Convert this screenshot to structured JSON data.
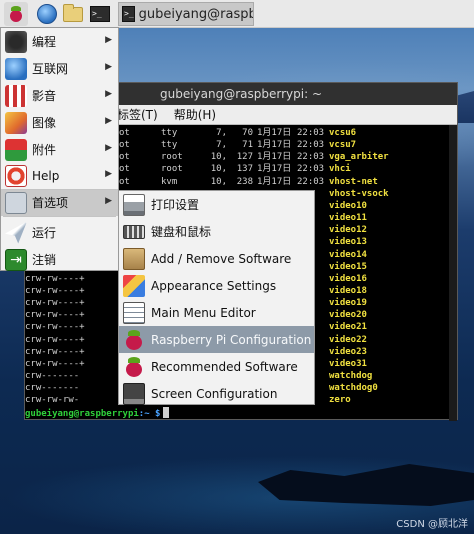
{
  "panel": {
    "task_title": "gubeiyang@raspberr",
    "term_glyph": ">_"
  },
  "terminal": {
    "title": "gubeiyang@raspberrypi: ~",
    "menu": [
      "标签(T)",
      "帮助(H)"
    ],
    "rows": [
      {
        "perm": "",
        "user": "ot",
        "grp": "tty",
        "maj": "7,",
        "min": "70",
        "date": "1月17日",
        "time": "22:03",
        "dev": "vcsu6"
      },
      {
        "perm": "",
        "user": "ot",
        "grp": "tty",
        "maj": "7,",
        "min": "71",
        "date": "1月17日",
        "time": "22:03",
        "dev": "vcsu7"
      },
      {
        "perm": "",
        "user": "ot",
        "grp": "root",
        "maj": "10,",
        "min": "127",
        "date": "1月17日",
        "time": "22:03",
        "dev": "vga_arbiter"
      },
      {
        "perm": "",
        "user": "ot",
        "grp": "root",
        "maj": "10,",
        "min": "137",
        "date": "1月17日",
        "time": "22:03",
        "dev": "vhci"
      },
      {
        "perm": "",
        "user": "ot",
        "grp": "kvm",
        "maj": "10,",
        "min": "238",
        "date": "1月17日",
        "time": "22:03",
        "dev": "vhost-net"
      },
      {
        "perm": "",
        "user": "",
        "grp": "",
        "maj": "",
        "min": "",
        "date": "",
        "time": "",
        "dev": "vhost-vsock"
      },
      {
        "perm": "",
        "user": "",
        "grp": "",
        "maj": "",
        "min": "",
        "date": "",
        "time": "",
        "dev": "video10"
      },
      {
        "perm": "",
        "user": "",
        "grp": "",
        "maj": "",
        "min": "",
        "date": "",
        "time": "",
        "dev": "video11"
      },
      {
        "perm": "",
        "user": "",
        "grp": "",
        "maj": "",
        "min": "",
        "date": "",
        "time": "",
        "dev": "video12"
      },
      {
        "perm": "",
        "user": "",
        "grp": "",
        "maj": "",
        "min": "",
        "date": "",
        "time": "",
        "dev": "video13"
      },
      {
        "perm": "",
        "user": "",
        "grp": "",
        "maj": "",
        "min": "",
        "date": "",
        "time": "",
        "dev": "video14"
      },
      {
        "perm": "",
        "user": "",
        "grp": "",
        "maj": "",
        "min": "",
        "date": "",
        "time": "",
        "dev": "video15"
      },
      {
        "perm": "crw-rw----+",
        "user": "1 ro",
        "grp": "",
        "maj": "",
        "min": "",
        "date": "",
        "time": "",
        "dev": "video16"
      },
      {
        "perm": "crw-rw----+",
        "user": "1 ro",
        "grp": "",
        "maj": "",
        "min": "",
        "date": "",
        "time": "",
        "dev": "video18"
      },
      {
        "perm": "crw-rw----+",
        "user": "1 ro",
        "grp": "",
        "maj": "",
        "min": "",
        "date": "",
        "time": "",
        "dev": "video19"
      },
      {
        "perm": "crw-rw----+",
        "user": "1 ro",
        "grp": "",
        "maj": "",
        "min": "",
        "date": "",
        "time": "",
        "dev": "video20"
      },
      {
        "perm": "crw-rw----+",
        "user": "1 ro",
        "grp": "",
        "maj": "",
        "min": "",
        "date": "",
        "time": "",
        "dev": "video21"
      },
      {
        "perm": "crw-rw----+",
        "user": "1 ro",
        "grp": "",
        "maj": "",
        "min": "",
        "date": "",
        "time": "",
        "dev": "video22"
      },
      {
        "perm": "crw-rw----+",
        "user": "1 ro",
        "grp": "",
        "maj": "",
        "min": "",
        "date": "",
        "time": "",
        "dev": "video23"
      },
      {
        "perm": "crw-rw----+",
        "user": "1 ro",
        "grp": "",
        "maj": "",
        "min": "",
        "date": "",
        "time": "",
        "dev": "video31"
      },
      {
        "perm": "crw-------",
        "user": "1 ro",
        "grp": "",
        "maj": "",
        "min": "",
        "date": "",
        "time": "",
        "dev": "watchdog"
      },
      {
        "perm": "crw-------",
        "user": "1 ro",
        "grp": "",
        "maj": "",
        "min": "",
        "date": "",
        "time": "",
        "dev": "watchdog0"
      },
      {
        "perm": "crw-rw-rw-",
        "user": "1 ro",
        "grp": "",
        "maj": "",
        "min": "",
        "date": "",
        "time": "",
        "dev": "zero"
      }
    ],
    "prompt_user": "gubeiyang@raspberrypi",
    "prompt_path": ":~ $"
  },
  "menu": {
    "items": [
      {
        "label": "编程",
        "icon": "programming-icon",
        "arrow": "▶"
      },
      {
        "label": "互联网",
        "icon": "internet-icon",
        "arrow": "▶"
      },
      {
        "label": "影音",
        "icon": "sound-video-icon",
        "arrow": "▶"
      },
      {
        "label": "图像",
        "icon": "graphics-icon",
        "arrow": "▶"
      },
      {
        "label": "附件",
        "icon": "accessories-icon",
        "arrow": "▶"
      },
      {
        "label": "Help",
        "icon": "help-icon",
        "arrow": "▶"
      },
      {
        "label": "首选项",
        "icon": "preferences-icon",
        "arrow": "▶"
      },
      {
        "label": "运行",
        "icon": "run-icon",
        "arrow": ""
      },
      {
        "label": "注销",
        "icon": "logout-icon",
        "arrow": ""
      }
    ]
  },
  "submenu": {
    "items": [
      {
        "label": "打印设置",
        "icon": "print-settings-icon"
      },
      {
        "label": "键盘和鼠标",
        "icon": "keyboard-mouse-icon"
      },
      {
        "label": "Add / Remove Software",
        "icon": "add-remove-software-icon"
      },
      {
        "label": "Appearance Settings",
        "icon": "appearance-settings-icon"
      },
      {
        "label": "Main Menu Editor",
        "icon": "main-menu-editor-icon"
      },
      {
        "label": "Raspberry Pi Configuration",
        "icon": "raspberry-pi-icon"
      },
      {
        "label": "Recommended Software",
        "icon": "recommended-software-icon"
      },
      {
        "label": "Screen Configuration",
        "icon": "screen-configuration-icon"
      }
    ]
  },
  "watermark": "CSDN @顾北洋"
}
